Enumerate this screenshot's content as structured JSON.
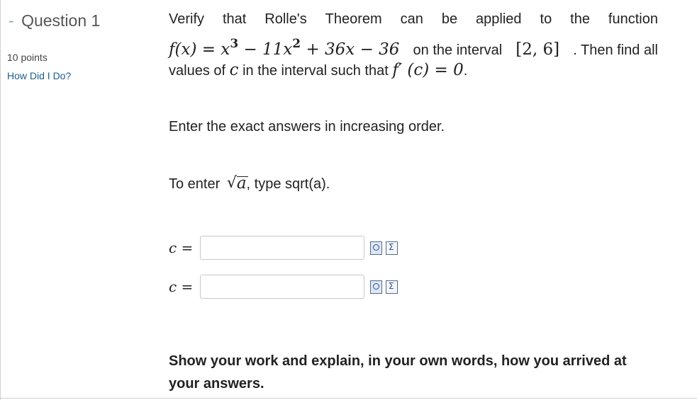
{
  "question": {
    "dash": "-",
    "title": "Question 1",
    "points": "10 points",
    "how_did_i_do": "How Did I Do?"
  },
  "problem": {
    "line1_words": [
      "Verify",
      "that",
      "Rolle's",
      "Theorem",
      "can",
      "be",
      "applied",
      "to",
      "the",
      "function"
    ],
    "func_f": "f",
    "func_args": "(x) = x",
    "exp1": "3",
    "mid": " − 11x",
    "exp2": "2",
    "tail": " + 36x − 36",
    "on_the_interval": "on the interval",
    "interval": "[2, 6]",
    "then_find_all": ". Then find all",
    "line3_prefix": "values of",
    "c_var": "c",
    "line3_mid": "in the interval such that",
    "derivative": "f′ (c) = 0",
    "line3_end": "."
  },
  "instructions": {
    "order": "Enter the exact answers in increasing order.",
    "sqrt_prefix": "To enter",
    "sqrt_var": "a",
    "sqrt_suffix": ", type sqrt(a)."
  },
  "answers": [
    {
      "label": "c =",
      "value": ""
    },
    {
      "label": "c =",
      "value": ""
    }
  ],
  "icons": {
    "preview": "preview-icon",
    "equation": "equation-editor-icon"
  },
  "work_prompt": "Show your work and explain, in your own words, how you arrived at your answers."
}
